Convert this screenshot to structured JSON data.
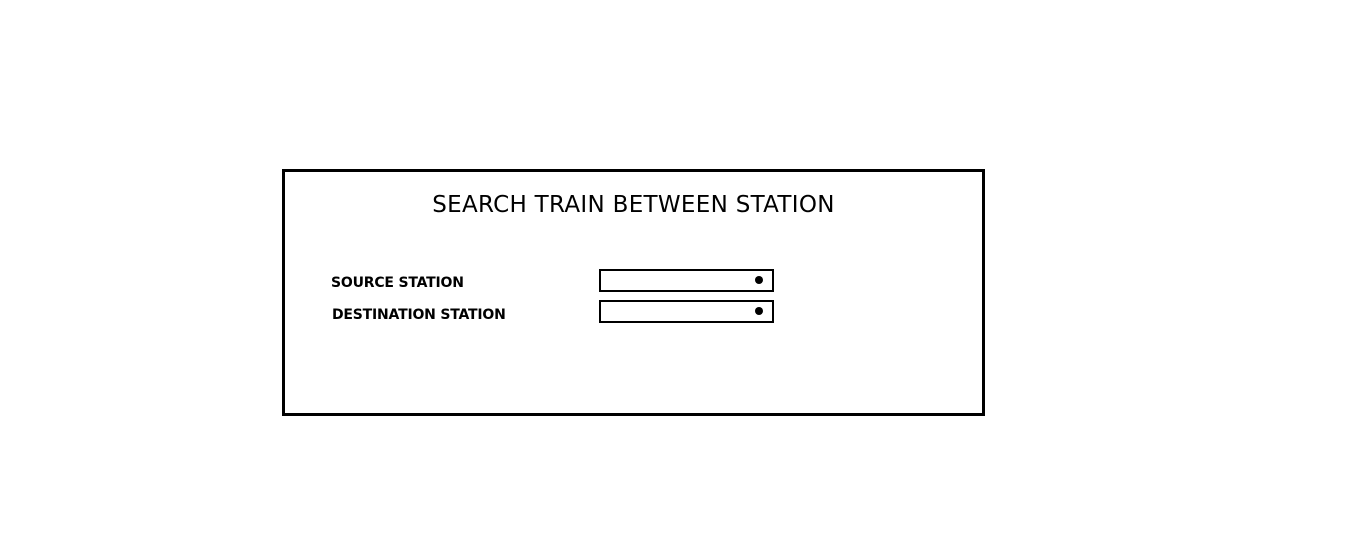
{
  "form": {
    "title": "SEARCH TRAIN BETWEEN STATION",
    "source": {
      "label": "SOURCE STATION",
      "selected_value": "",
      "icon": "dropdown-dot-icon"
    },
    "destination": {
      "label": "DESTINATION STATION",
      "selected_value": "",
      "icon": "dropdown-dot-icon"
    }
  },
  "colors": {
    "border": "#000000",
    "background": "#ffffff",
    "text": "#000000"
  }
}
